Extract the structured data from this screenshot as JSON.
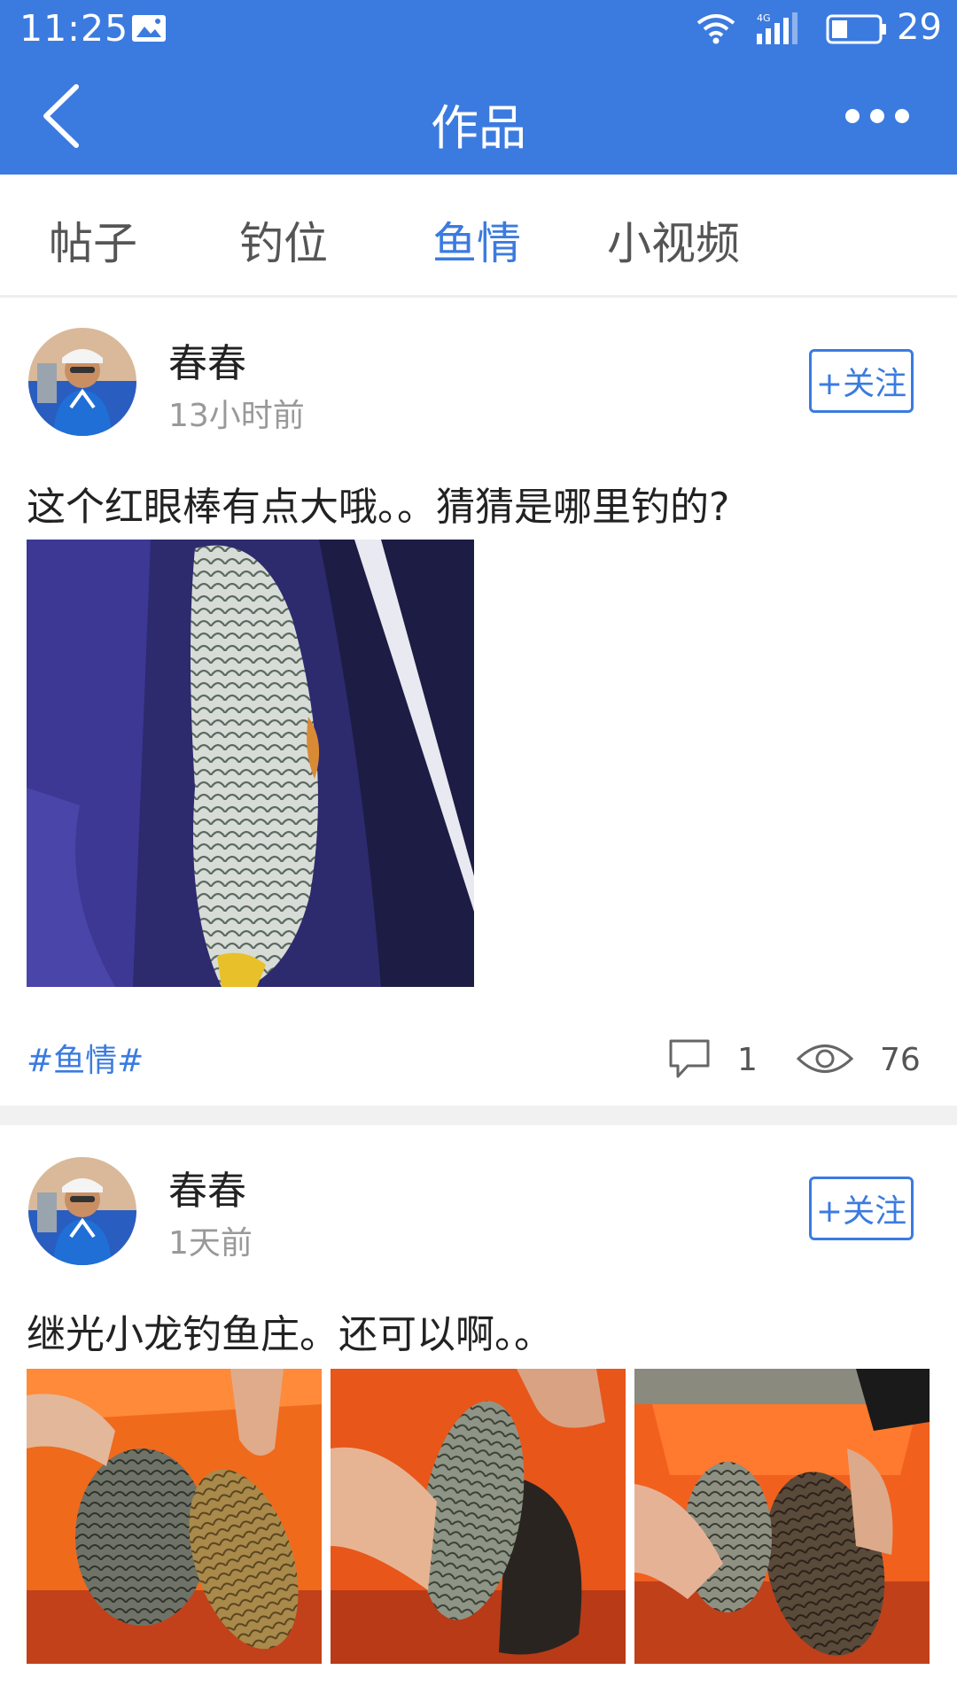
{
  "status_bar": {
    "time": "11:25",
    "network": "4G",
    "battery_percent": "29"
  },
  "header": {
    "title": "作品",
    "back_icon": "chevron-left-icon",
    "more_icon": "more-horizontal-icon",
    "color": "#3b7be0"
  },
  "tabs": [
    {
      "label": "帖子",
      "active": false
    },
    {
      "label": "钓位",
      "active": false
    },
    {
      "label": "鱼情",
      "active": true
    },
    {
      "label": "小视频",
      "active": false
    }
  ],
  "posts": [
    {
      "author": "春春",
      "time": "13小时前",
      "follow_label": "+关注",
      "text": "这个红眼棒有点大哦。。猜猜是哪里钓的?",
      "tag": "#鱼情#",
      "comments": "1",
      "views": "76"
    },
    {
      "author": "春春",
      "time": "1天前",
      "follow_label": "+关注",
      "text": "继光小龙钓鱼庄。还可以啊。。"
    }
  ]
}
